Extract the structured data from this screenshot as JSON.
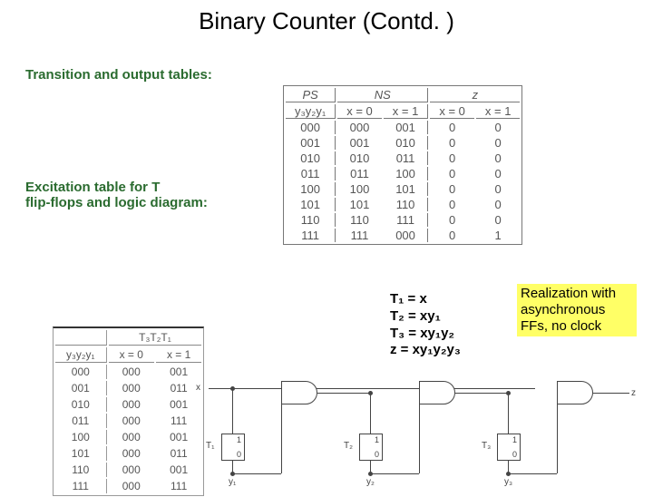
{
  "title": "Binary Counter (Contd. )",
  "label_transition": "Transition and output tables:",
  "label_excitation_line1": "Excitation table for T",
  "label_excitation_line2": "flip-flops and logic diagram:",
  "trans_table": {
    "group_headers": [
      "PS",
      "NS",
      "z"
    ],
    "sub_headers": [
      "y₃y₂y₁",
      "x = 0",
      "x = 1",
      "x = 0",
      "x = 1"
    ],
    "rows": [
      [
        "000",
        "000",
        "001",
        "0",
        "0"
      ],
      [
        "001",
        "001",
        "010",
        "0",
        "0"
      ],
      [
        "010",
        "010",
        "011",
        "0",
        "0"
      ],
      [
        "011",
        "011",
        "100",
        "0",
        "0"
      ],
      [
        "100",
        "100",
        "101",
        "0",
        "0"
      ],
      [
        "101",
        "101",
        "110",
        "0",
        "0"
      ],
      [
        "110",
        "110",
        "111",
        "0",
        "0"
      ],
      [
        "111",
        "111",
        "000",
        "0",
        "1"
      ]
    ]
  },
  "exc_table": {
    "group_header": "T₃T₂T₁",
    "sub_headers": [
      "y₃y₂y₁",
      "x = 0",
      "x = 1"
    ],
    "rows": [
      [
        "000",
        "000",
        "001"
      ],
      [
        "001",
        "000",
        "011"
      ],
      [
        "010",
        "000",
        "001"
      ],
      [
        "011",
        "000",
        "111"
      ],
      [
        "100",
        "000",
        "001"
      ],
      [
        "101",
        "000",
        "011"
      ],
      [
        "110",
        "000",
        "001"
      ],
      [
        "111",
        "000",
        "111"
      ]
    ]
  },
  "equations": {
    "t1": "T₁ = x",
    "t2": "T₂ = xy₁",
    "t3": "T₃ = xy₁y₂",
    "z": "z = xy₁y₂y₃"
  },
  "highlight": "Realization with asynchronous FFs, no clock",
  "circuit": {
    "input": "x",
    "output": "z",
    "ff_labels": [
      "T₁",
      "T₂",
      "T₃"
    ],
    "state_labels": [
      "y₁",
      "y₂",
      "y₃"
    ]
  }
}
